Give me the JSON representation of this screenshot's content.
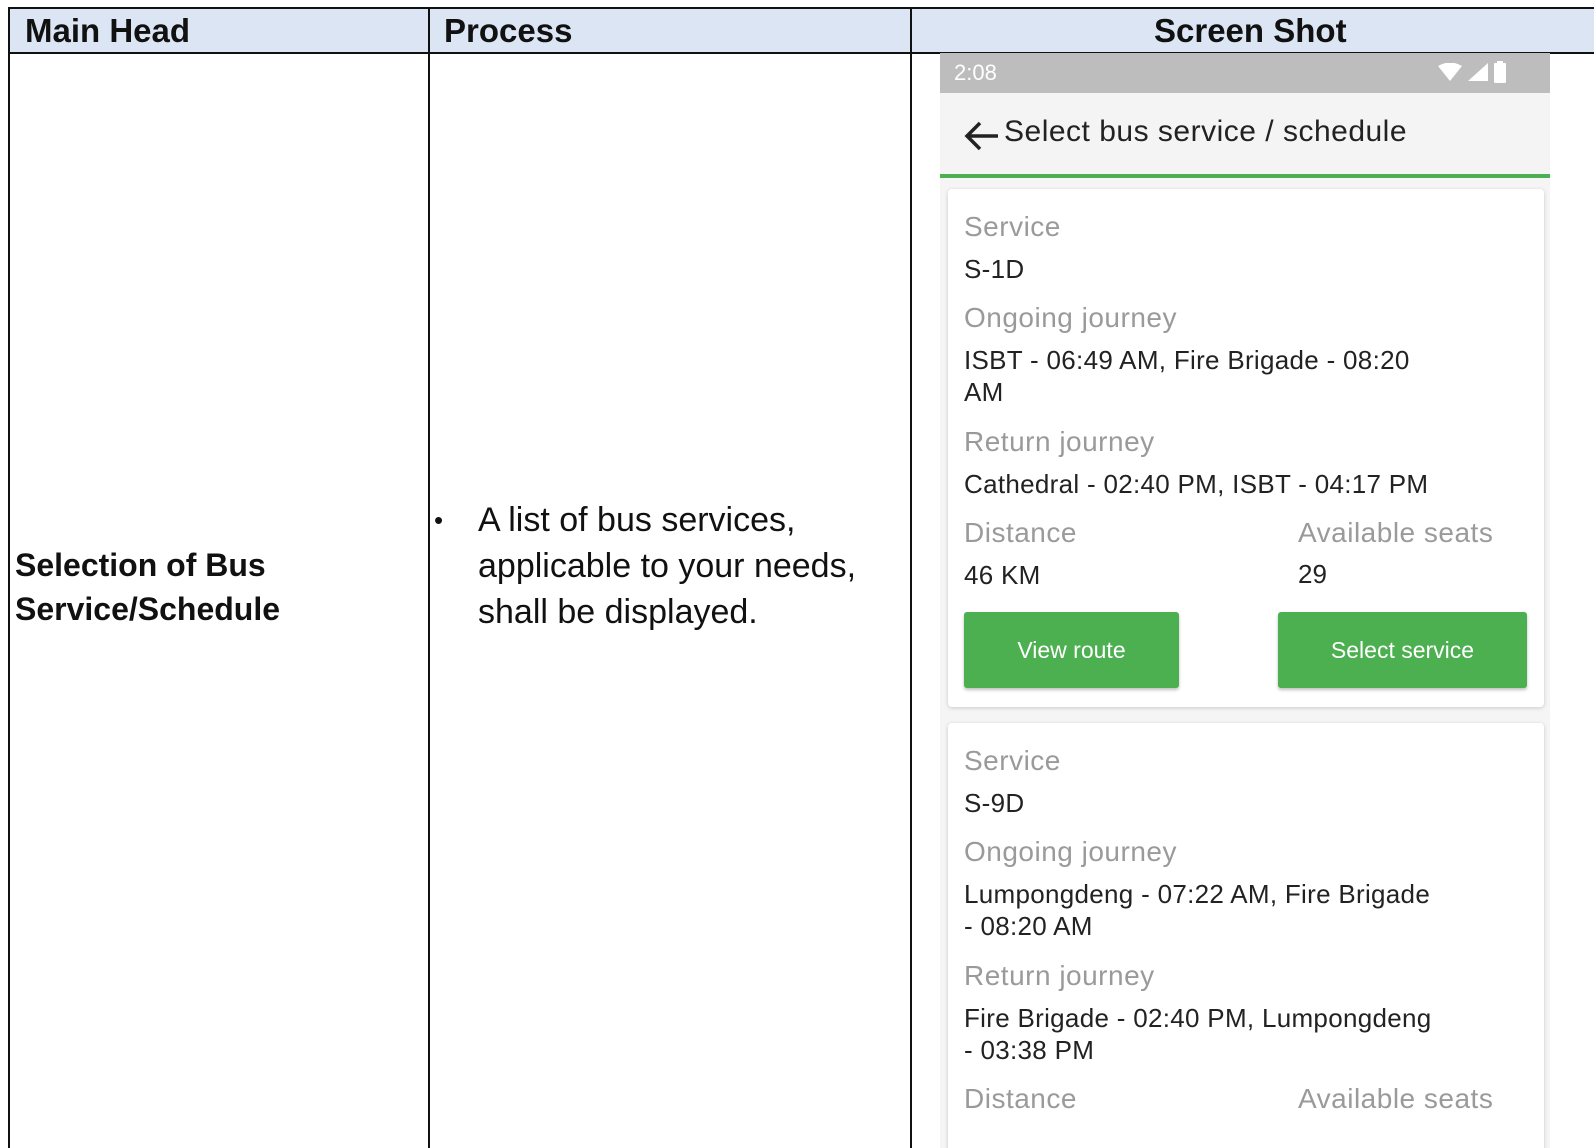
{
  "table": {
    "headers": [
      "Main Head",
      "Process",
      "Screen Shot"
    ],
    "main_head": [
      "Selection of Bus",
      "Service/Schedule"
    ],
    "process_bullet": "•",
    "process_lines": [
      "A list of bus services,",
      "applicable to your needs,",
      "shall be displayed."
    ]
  },
  "phone": {
    "status_time": "2:08",
    "appbar_title": "Select bus service / schedule",
    "labels": {
      "service": "Service",
      "ongoing": "Ongoing journey",
      "return": "Return journey",
      "distance": "Distance",
      "seats": "Available seats"
    },
    "cards": [
      {
        "service": "S-1D",
        "ongoing_lines": [
          "ISBT - 06:49 AM, Fire Brigade - 08:20",
          "AM"
        ],
        "return_lines": [
          "Cathedral - 02:40 PM, ISBT - 04:17 PM"
        ],
        "distance": "46 KM",
        "seats": "29",
        "view_route": "View route",
        "select_service": "Select service"
      },
      {
        "service": "S-9D",
        "ongoing_lines": [
          "Lumpongdeng - 07:22 AM, Fire Brigade",
          "- 08:20 AM"
        ],
        "return_lines": [
          "Fire Brigade - 02:40 PM, Lumpongdeng",
          "- 03:38 PM"
        ]
      }
    ],
    "accent_color": "#4caf50"
  }
}
